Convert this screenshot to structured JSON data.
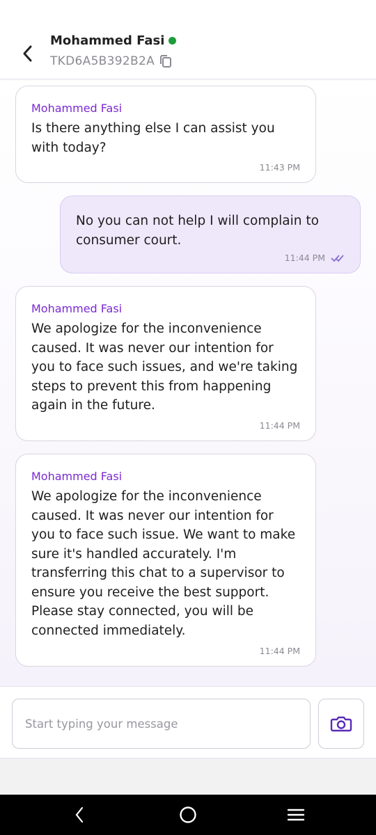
{
  "header": {
    "agent_name": "Mohammed Fasi",
    "ticket_id": "TKD6A5B392B2A",
    "online_color": "#1f9d3a"
  },
  "messages": [
    {
      "from": "agent",
      "sender": "Mohammed Fasi",
      "text": "Is there anything else I can assist you with today?",
      "time": "11:43 PM"
    },
    {
      "from": "user",
      "text": "No you can not help I will complain to consumer court.",
      "time": "11:44 PM",
      "read": true
    },
    {
      "from": "agent",
      "sender": "Mohammed Fasi",
      "text": "We apologize for the inconvenience caused. It was never our intention for you to face such issues, and we're taking steps to prevent this from happening again in the future.",
      "time": "11:44 PM"
    },
    {
      "from": "agent",
      "sender": "Mohammed Fasi",
      "text": "We apologize for the inconvenience caused. It was never our intention for you to face such issue. We want to make sure it's handled accurately. I'm transferring this chat to a supervisor to ensure you receive the best support. Please stay connected, you will be connected immediately.",
      "time": "11:44 PM"
    }
  ],
  "composer": {
    "placeholder": "Start typing your message",
    "accent": "#5a2bb8"
  },
  "icons": {
    "back": "chevron-left-icon",
    "copy": "copy-icon",
    "camera": "camera-icon",
    "read_receipt": "double-check-icon"
  }
}
